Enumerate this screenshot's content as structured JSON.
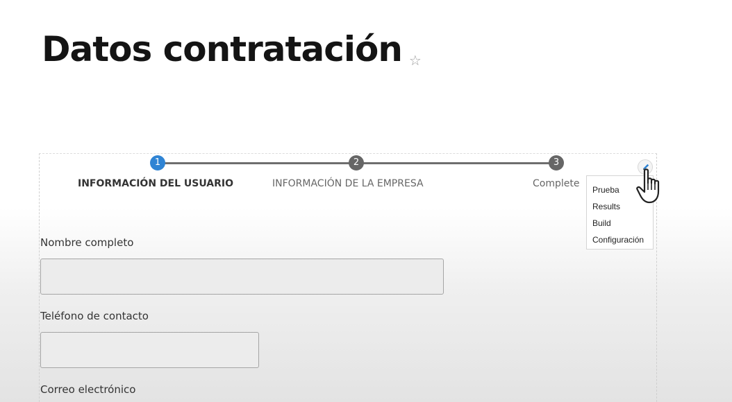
{
  "page": {
    "title": "Datos contratación"
  },
  "stepper": {
    "steps": [
      {
        "number": "1",
        "label": "INFORMACIÓN DEL USUARIO",
        "state": "active"
      },
      {
        "number": "2",
        "label": "INFORMACIÓN DE LA EMPRESA",
        "state": "inactive"
      },
      {
        "number": "3",
        "label": "Complete",
        "state": "inactive"
      }
    ]
  },
  "context_menu": {
    "items": [
      "Prueba",
      "Results",
      "Build",
      "Configuración"
    ]
  },
  "form": {
    "fields": [
      {
        "label": "Nombre completo",
        "value": ""
      },
      {
        "label": "Teléfono de contacto",
        "value": ""
      },
      {
        "label": "Correo electrónico"
      }
    ]
  },
  "colors": {
    "step_active": "#2f84d4",
    "step_inactive": "#666666",
    "stepper_line": "#6e6e6e"
  },
  "icons": {
    "favorite": "star-outline-icon",
    "edit": "pencil-icon",
    "cursor": "hand-pointer-icon"
  }
}
